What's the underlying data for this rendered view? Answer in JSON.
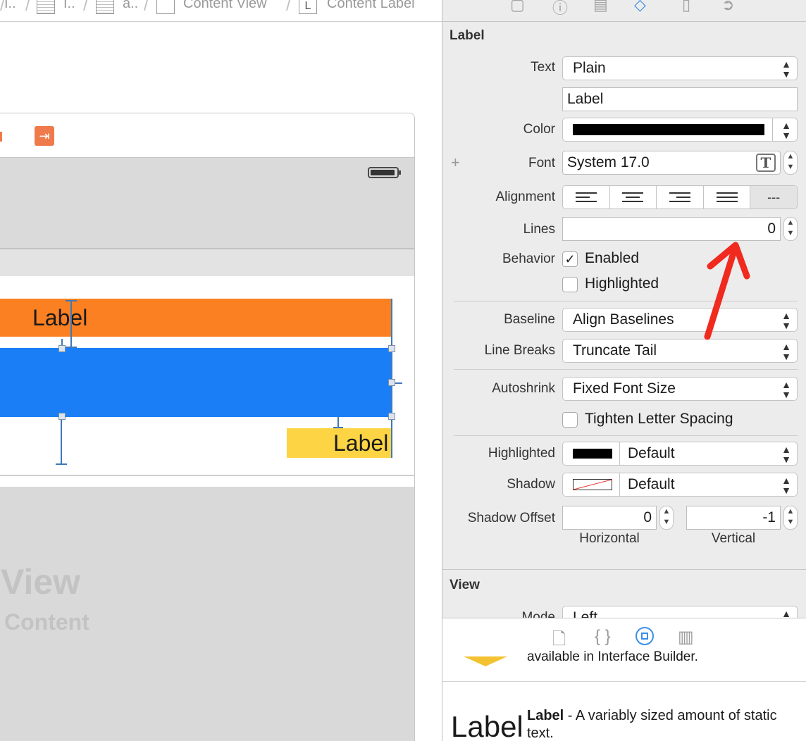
{
  "breadcrumb": {
    "items": [
      "I..",
      "I..",
      "a..",
      "Content View",
      "Content Label"
    ],
    "icon_letter": "L"
  },
  "canvas": {
    "orange_label": "Label",
    "yellow_label": "Label",
    "view_text": "View",
    "content_text": "Content",
    "colors": {
      "orange": "#fb8022",
      "blue": "#1a7ff7",
      "yellow": "#fdd443"
    }
  },
  "inspector": {
    "toolbar_icons": [
      "file-icon",
      "help-icon",
      "identity-icon",
      "attributes-icon",
      "size-icon",
      "connections-icon"
    ],
    "label_section": {
      "title": "Label",
      "text_label": "Text",
      "text_type": "Plain",
      "text_value": "Label",
      "color_label": "Color",
      "color_value": "#000000",
      "font_label": "Font",
      "font_value": "System 17.0",
      "alignment_label": "Alignment",
      "alignment_last": "---",
      "lines_label": "Lines",
      "lines_value": "0",
      "behavior_label": "Behavior",
      "enabled_label": "Enabled",
      "enabled_checked": true,
      "highlighted_label": "Highlighted",
      "highlighted_checked": false,
      "baseline_label": "Baseline",
      "baseline_value": "Align Baselines",
      "line_breaks_label": "Line Breaks",
      "line_breaks_value": "Truncate Tail",
      "autoshrink_label": "Autoshrink",
      "autoshrink_value": "Fixed Font Size",
      "tighten_label": "Tighten Letter Spacing",
      "tighten_checked": false,
      "highlighted_color_label": "Highlighted",
      "highlighted_color_value": "Default",
      "shadow_label": "Shadow",
      "shadow_value": "Default",
      "shadow_offset_label": "Shadow Offset",
      "shadow_h_value": "0",
      "shadow_v_value": "-1",
      "horizontal_label": "Horizontal",
      "vertical_label": "Vertical"
    },
    "view_section": {
      "title": "View",
      "mode_label": "Mode",
      "mode_value": "Left"
    },
    "library": {
      "tab_icons": [
        "file-template-icon",
        "code-snippet-icon",
        "object-library-icon",
        "media-library-icon"
      ],
      "partial_text": "available in Interface Builder.",
      "item_preview": "Label",
      "item_name": "Label",
      "item_desc": " - A variably sized amount of static text."
    }
  }
}
